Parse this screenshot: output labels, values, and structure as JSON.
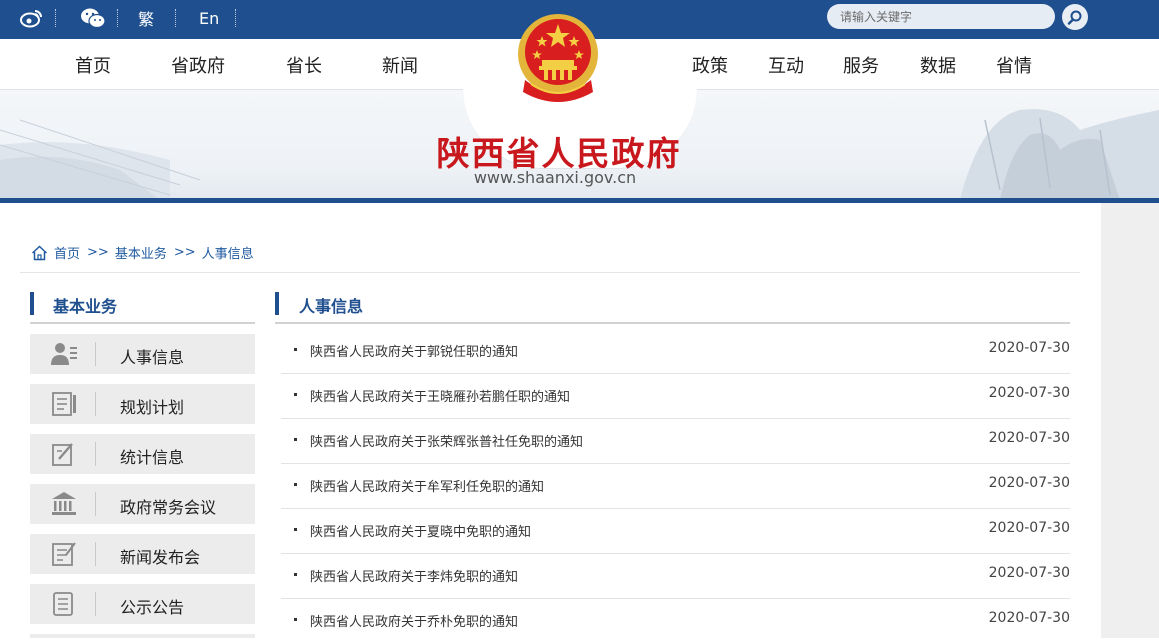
{
  "topbar": {
    "traditional_label": "繁",
    "english_label": "En",
    "search_placeholder": "请输入关键字"
  },
  "nav": {
    "left": [
      "首页",
      "省政府",
      "省长",
      "新闻"
    ],
    "right": [
      "政策",
      "互动",
      "服务",
      "数据",
      "省情"
    ]
  },
  "banner": {
    "title": "陕西省人民政府",
    "url": "www.shaanxi.gov.cn"
  },
  "breadcrumb": {
    "home": "首页",
    "sep1": ">>",
    "section": "基本业务",
    "sep2": ">>",
    "current": "人事信息"
  },
  "sidebar": {
    "heading": "基本业务",
    "items": [
      {
        "label": "人事信息",
        "icon": "person-card-icon"
      },
      {
        "label": "规划计划",
        "icon": "document-list-icon"
      },
      {
        "label": "统计信息",
        "icon": "edit-note-icon"
      },
      {
        "label": "政府常务会议",
        "icon": "government-building-icon"
      },
      {
        "label": "新闻发布会",
        "icon": "news-edit-icon"
      },
      {
        "label": "公示公告",
        "icon": "notice-doc-icon"
      }
    ]
  },
  "main": {
    "heading": "人事信息",
    "articles": [
      {
        "title": "陕西省人民政府关于郭锐任职的通知",
        "date": "2020-07-30"
      },
      {
        "title": "陕西省人民政府关于王晓雁孙若鹏任职的通知",
        "date": "2020-07-30"
      },
      {
        "title": "陕西省人民政府关于张荣辉张普社任免职的通知",
        "date": "2020-07-30"
      },
      {
        "title": "陕西省人民政府关于牟军利任免职的通知",
        "date": "2020-07-30"
      },
      {
        "title": "陕西省人民政府关于夏晓中免职的通知",
        "date": "2020-07-30"
      },
      {
        "title": "陕西省人民政府关于李炜免职的通知",
        "date": "2020-07-30"
      },
      {
        "title": "陕西省人民政府关于乔朴免职的通知",
        "date": "2020-07-30"
      }
    ]
  },
  "colors": {
    "primary_blue": "#1f4f8e",
    "title_red": "#c8171d",
    "link_blue": "#1f5aa0"
  }
}
